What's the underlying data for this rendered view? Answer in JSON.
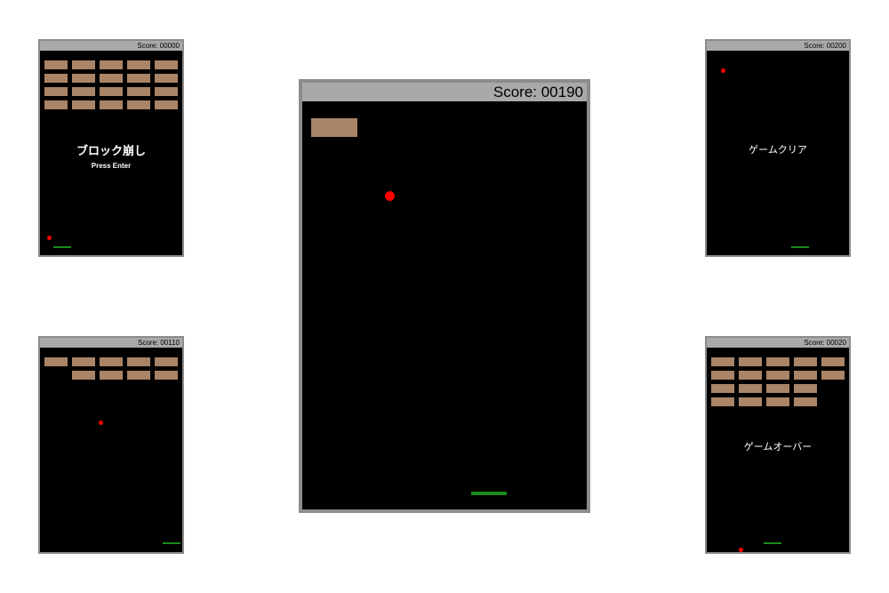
{
  "colors": {
    "frame": "#8c8c8c",
    "score_bar": "#a9a9a9",
    "playfield": "#000000",
    "brick": "#a98467",
    "ball": "#ff0000",
    "paddle": "#1a8a1a",
    "overlay_text": "#ffffff"
  },
  "screens": {
    "title": {
      "score": "Score: 00000",
      "title_text": "ブロック崩し",
      "prompt_text": "Press Enter"
    },
    "midgame": {
      "score": "Score: 00110"
    },
    "main": {
      "score": "Score: 00190"
    },
    "clear": {
      "score": "Score: 00200",
      "message": "ゲームクリア"
    },
    "gameover": {
      "score": "Score: 00020",
      "message": "ゲームオーバー"
    }
  }
}
